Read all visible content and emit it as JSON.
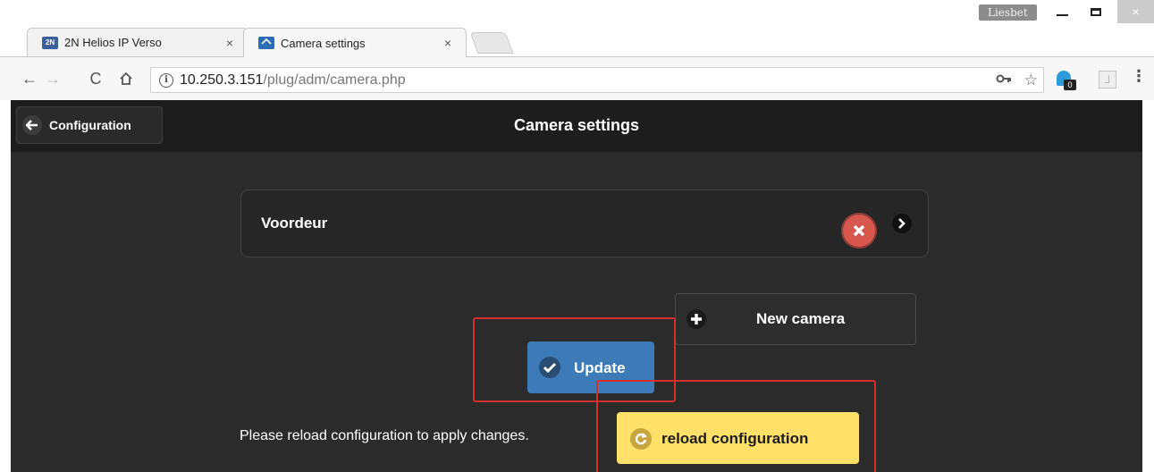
{
  "browser": {
    "profile_name": "Liesbet",
    "tabs": [
      {
        "favicon_text": "2N",
        "title": "2N Helios IP Verso",
        "active": false
      },
      {
        "favicon_text": "",
        "title": "Camera settings",
        "active": true
      }
    ],
    "tab_close_glyph": "×",
    "window_close_glyph": "×",
    "address": {
      "host": "10.250.3.151",
      "path": "/plug/adm/camera.php"
    },
    "extension_badge": "0"
  },
  "app": {
    "back_button_label": "Configuration",
    "page_title": "Camera settings",
    "cameras": [
      {
        "name": "Voordeur"
      }
    ],
    "new_camera_label": "New camera",
    "update_label": "Update",
    "reload_message": "Please reload configuration to apply changes.",
    "reload_label": "reload configuration"
  },
  "colors": {
    "page_background": "#2b2b2b",
    "header_background": "#1d1d1d",
    "update_button": "#3c7ab8",
    "reload_button": "#ffe16a",
    "delete_icon": "#d8584f",
    "highlight": "#d32f2f"
  }
}
